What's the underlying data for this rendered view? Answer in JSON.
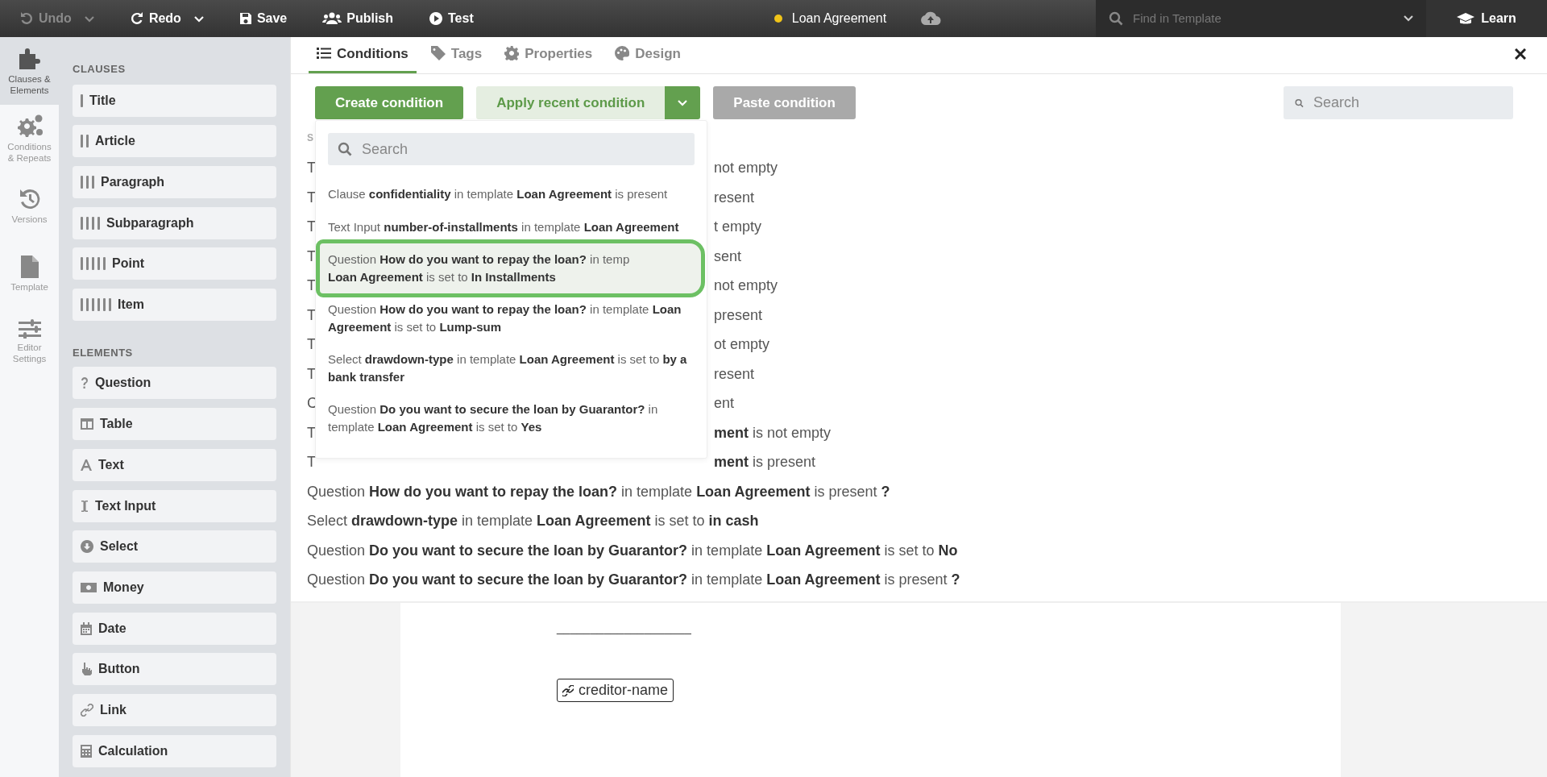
{
  "toolbar": [
    {
      "label": "Undo",
      "disabled": true,
      "caret": true
    },
    {
      "label": "Redo",
      "disabled": false,
      "caret": true
    },
    {
      "label": "Save",
      "disabled": false,
      "caret": false
    },
    {
      "label": "Publish",
      "disabled": false,
      "caret": false
    },
    {
      "label": "Test",
      "disabled": false,
      "caret": false
    }
  ],
  "document_title": {
    "label": "Loan Agreement",
    "unsaved": true
  },
  "find": {
    "placeholder": "Find in Template"
  },
  "learn": "Learn",
  "rail": [
    {
      "label": "Clauses & Elements",
      "selected": true
    },
    {
      "label": "Conditions & Repeats",
      "selected": false
    },
    {
      "label": "Versions",
      "selected": false
    },
    {
      "label": "Template",
      "selected": false
    },
    {
      "label": "Editor Settings",
      "selected": false
    }
  ],
  "clauses": {
    "heading": "CLAUSES",
    "items": [
      "Title",
      "Article",
      "Paragraph",
      "Subparagraph",
      "Point",
      "Item"
    ]
  },
  "elements": {
    "heading": "ELEMENTS",
    "items": [
      "Question",
      "Table",
      "Text",
      "Text Input",
      "Select",
      "Money",
      "Date",
      "Button",
      "Link",
      "Calculation"
    ]
  },
  "tabs": [
    {
      "label": "Conditions",
      "selected": true
    },
    {
      "label": "Tags",
      "selected": false
    },
    {
      "label": "Properties",
      "selected": false
    },
    {
      "label": "Design",
      "selected": false
    }
  ],
  "actions": {
    "create": "Create condition",
    "apply": "Apply recent condition",
    "paste": {
      "label": "Paste condition",
      "disabled": true
    }
  },
  "search": {
    "placeholder": "Search"
  },
  "dropdown": {
    "search_placeholder": "Search",
    "items": [
      {
        "text": "Clause **confidentiality** in template **Loan Agreement** is present",
        "highlighted": false
      },
      {
        "text": "Text Input **number-of-installments** in template **Loan Agreement**",
        "highlighted": false
      },
      {
        "text": "Question **How do you want to repay the loan?** in temp",
        "highlighted": true,
        "second": "**Loan Agreement** is set to **In Installments**"
      },
      {
        "text": "Question **How do you want to repay the loan?** in template **Loan Agreement** is set to **Lump-sum**",
        "highlighted": false
      },
      {
        "text": "Select **drawdown-type** in template **Loan Agreement** is set to **by a bank transfer**",
        "highlighted": false
      },
      {
        "text": "Question **Do you want to secure the loan by Guarantor?** in template **Loan Agreement** is set to **Yes**",
        "highlighted": false
      }
    ]
  },
  "conditions": {
    "heading": "S",
    "rows": [
      {
        "kind": "covered",
        "start": "T",
        "end": "not empty"
      },
      {
        "kind": "covered",
        "start": "T",
        "end": "resent"
      },
      {
        "kind": "covered",
        "start": "T",
        "end": "t empty"
      },
      {
        "kind": "covered",
        "start": "T",
        "end": "sent"
      },
      {
        "kind": "covered",
        "start": "T",
        "end": "not empty"
      },
      {
        "kind": "covered",
        "start": "T",
        "end": "present"
      },
      {
        "kind": "covered",
        "start": "T",
        "end": "ot empty"
      },
      {
        "kind": "covered",
        "start": "T",
        "end": "resent"
      },
      {
        "kind": "covered",
        "start": "C",
        "end": "ent"
      },
      {
        "kind": "covered",
        "start": "T",
        "end": "**ment** is not empty"
      },
      {
        "kind": "covered",
        "start": "T",
        "end": "**ment** is present"
      },
      {
        "kind": "full",
        "text": "Question **How do you want to repay the loan?** in template **Loan Agreement** is present **?**"
      },
      {
        "kind": "full",
        "text": "Select **drawdown-type** in template **Loan Agreement** is set to **in cash**"
      },
      {
        "kind": "full",
        "text": "Question **Do you want to secure the loan by Guarantor?** in template **Loan Agreement** is set to **No**"
      },
      {
        "kind": "full",
        "text": "Question **Do you want to secure the loan by Guarantor?** in template **Loan Agreement** is present **?**"
      }
    ]
  },
  "document": {
    "rule": "____________________",
    "field": "creditor-name"
  }
}
